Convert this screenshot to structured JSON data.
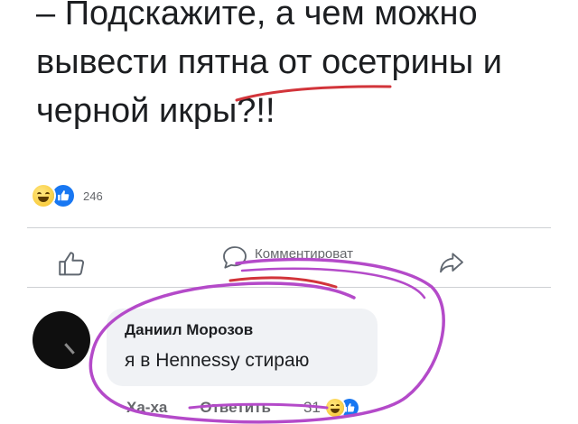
{
  "post": {
    "lines": [
      "– Подскажите, а чем можно",
      "вывести пятна от осетрины и",
      "черной икры?!!"
    ],
    "reaction_count": "246"
  },
  "actions": {
    "comment_label": "Комментироват"
  },
  "comment": {
    "author": "Даниил Морозов",
    "text": "я в Hennessy стираю",
    "laugh_label": "Ха-ха",
    "reply_label": "Ответить",
    "reaction_count": "31"
  },
  "colors": {
    "like_blue": "#1877f2",
    "bubble_bg": "#f0f2f5",
    "secondary_text": "#65676b",
    "annotation_red": "#d2343a",
    "annotation_purple": "#b44ac9"
  },
  "icons": [
    "laugh-emoji-icon",
    "like-badge-icon",
    "thumbs-up-icon",
    "comment-icon",
    "share-icon"
  ]
}
